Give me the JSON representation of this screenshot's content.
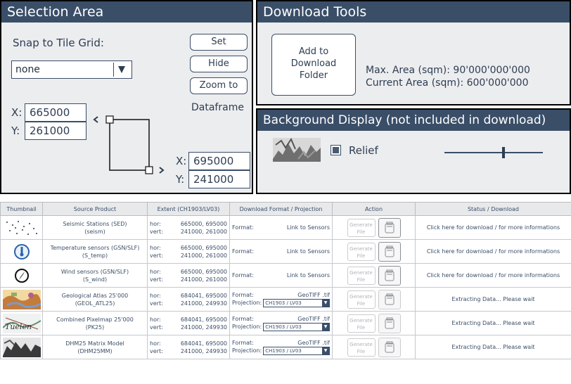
{
  "selection": {
    "title": "Selection Area",
    "snap_label": "Snap to Tile Grid:",
    "snap_value": "none",
    "set_button": "Set",
    "hide_button": "Hide",
    "zoom_button": "Zoom to",
    "dataframe_label": "Dataframe",
    "x_label": "X:",
    "y_label": "Y:",
    "upper_left_x": "665000",
    "upper_left_y": "261000",
    "lower_right_x": "695000",
    "lower_right_y": "241000"
  },
  "download": {
    "title": "Download Tools",
    "add_button": "Add to\nDownload\nFolder",
    "max_area": "Max. Area (sqm): 90'000'000'000",
    "current_area": "Current Area (sqm): 600'000'000"
  },
  "background": {
    "title": "Background Display (not included in download)",
    "relief_label": "Relief",
    "relief_checked": true,
    "opacity_level": 0.6
  },
  "table": {
    "headers": [
      "Thumbnail",
      "Source Product",
      "Extent (CH1903/LV03)",
      "Download Format / Projection",
      "Action",
      "Status / Download"
    ],
    "hor_label": "hor:",
    "vert_label": "vert:",
    "format_label": "Format:",
    "projection_label": "Projection:",
    "generate_label": "Generate File",
    "rows": [
      {
        "thumb_icon": "seismic-dots-icon",
        "product": "Seismic Stations (SED)",
        "code": "(seism)",
        "hor": "665000, 695000",
        "vert": "241000, 261000",
        "format": "Link to Sensors",
        "projection": "",
        "status": "Click here for download / for more informations"
      },
      {
        "thumb_icon": "thermometer-icon",
        "product": "Temperature sensors (GSN/SLF)",
        "code": "(S_temp)",
        "hor": "665000, 695000",
        "vert": "241000, 261000",
        "format": "Link to Sensors",
        "projection": "",
        "status": "Click here for download / for more informations"
      },
      {
        "thumb_icon": "compass-icon",
        "product": "Wind sensors (GSN/SLF)",
        "code": "(S_wind)",
        "hor": "665000, 695000",
        "vert": "241000, 261000",
        "format": "Link to Sensors",
        "projection": "",
        "status": "Click here for download / for more informations"
      },
      {
        "thumb_icon": "geology-map-icon",
        "product": "Geological Atlas 25'000",
        "code": "(GEOL_ATL25)",
        "hor": "684041, 695000",
        "vert": "241000, 249930",
        "format": "GeoTIFF .tif",
        "projection": "CH1903 / LV03",
        "status": "Extracting Data... Please wait"
      },
      {
        "thumb_icon": "pixelmap-icon",
        "product": "Combined Pixelmap 25'000",
        "code": "(PK25)",
        "hor": "684041, 695000",
        "vert": "241000, 249930",
        "format": "GeoTIFF .tif",
        "projection": "CH1903 / LV03",
        "status": "Extracting Data... Please wait"
      },
      {
        "thumb_icon": "relief-map-icon",
        "product": "DHM25 Matrix Model",
        "code": "(DHM25MM)",
        "hor": "684041, 695000",
        "vert": "241000, 249930",
        "format": "GeoTIFF .tif",
        "projection": "CH1903 / LV03",
        "status": "Extracting Data... Please wait"
      }
    ]
  }
}
